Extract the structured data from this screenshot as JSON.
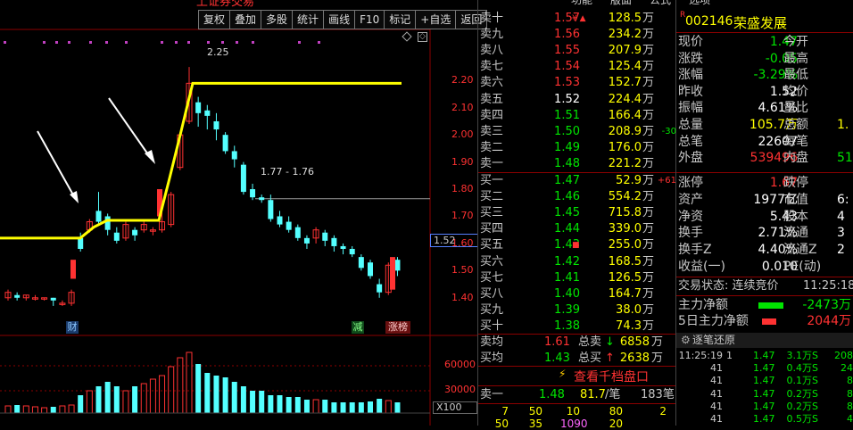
{
  "header": {
    "top_tabs": [
      "功能",
      "版面",
      "公式",
      "选项"
    ],
    "title_fragment": "上证券交易"
  },
  "toolbar": {
    "buttons": [
      "复权",
      "叠加",
      "多股",
      "统计",
      "画线",
      "F10",
      "标记",
      "+自选",
      "返回"
    ]
  },
  "chart": {
    "price_labels": [
      "2.20",
      "2.10",
      "2.00",
      "1.90",
      "1.80",
      "1.70",
      "1.60",
      "1.50",
      "1.40"
    ],
    "volume_labels": [
      "60000",
      "30000"
    ],
    "volume_unit": "X100",
    "current_price_tag": "1.52",
    "high_annotation": "2.25",
    "range_annotation": "1.77 - 1.76",
    "event_tags": [
      "财",
      "减",
      "涨榜"
    ],
    "colors": {
      "up": "#ff3232",
      "down": "#54ffff",
      "ma": "#ffff00",
      "bg": "#000000"
    }
  },
  "chart_data": {
    "type": "candlestick",
    "ylim": [
      1.35,
      2.27
    ],
    "ma_line_label": "",
    "candles": [
      {
        "o": 1.4,
        "c": 1.42,
        "h": 1.43,
        "l": 1.39
      },
      {
        "o": 1.41,
        "c": 1.4,
        "h": 1.42,
        "l": 1.39
      },
      {
        "o": 1.4,
        "c": 1.41,
        "h": 1.41,
        "l": 1.39
      },
      {
        "o": 1.4,
        "c": 1.4,
        "h": 1.41,
        "l": 1.39
      },
      {
        "o": 1.4,
        "c": 1.4,
        "h": 1.4,
        "l": 1.39
      },
      {
        "o": 1.4,
        "c": 1.39,
        "h": 1.4,
        "l": 1.37
      },
      {
        "o": 1.38,
        "c": 1.38,
        "h": 1.39,
        "l": 1.37
      },
      {
        "o": 1.38,
        "c": 1.42,
        "h": 1.43,
        "l": 1.37
      },
      {
        "o": 1.62,
        "c": 1.58,
        "h": 1.64,
        "l": 1.57
      },
      {
        "o": 1.65,
        "c": 1.68,
        "h": 1.69,
        "l": 1.64
      },
      {
        "o": 1.72,
        "c": 1.68,
        "h": 1.79,
        "l": 1.67
      },
      {
        "o": 1.7,
        "c": 1.65,
        "h": 1.71,
        "l": 1.63
      },
      {
        "o": 1.64,
        "c": 1.61,
        "h": 1.66,
        "l": 1.6
      },
      {
        "o": 1.62,
        "c": 1.67,
        "h": 1.68,
        "l": 1.61
      },
      {
        "o": 1.65,
        "c": 1.63,
        "h": 1.66,
        "l": 1.61
      },
      {
        "o": 1.65,
        "c": 1.67,
        "h": 1.68,
        "l": 1.64
      },
      {
        "o": 1.65,
        "c": 1.65,
        "h": 1.66,
        "l": 1.63
      },
      {
        "o": 1.65,
        "c": 1.68,
        "h": 1.7,
        "l": 1.64
      },
      {
        "o": 1.67,
        "c": 1.78,
        "h": 1.79,
        "l": 1.66
      },
      {
        "o": 1.88,
        "c": 2.0,
        "h": 2.01,
        "l": 1.87
      },
      {
        "o": 2.05,
        "c": 2.19,
        "h": 2.25,
        "l": 2.04
      },
      {
        "o": 2.12,
        "c": 2.08,
        "h": 2.14,
        "l": 2.03
      },
      {
        "o": 2.09,
        "c": 2.07,
        "h": 2.11,
        "l": 2.02
      },
      {
        "o": 2.05,
        "c": 2.02,
        "h": 2.08,
        "l": 1.98
      },
      {
        "o": 2.0,
        "c": 1.94,
        "h": 2.01,
        "l": 1.93
      },
      {
        "o": 1.94,
        "c": 1.91,
        "h": 1.96,
        "l": 1.88
      },
      {
        "o": 1.89,
        "c": 1.79,
        "h": 1.9,
        "l": 1.78
      },
      {
        "o": 1.8,
        "c": 1.77,
        "h": 1.82,
        "l": 1.76
      },
      {
        "o": 1.77,
        "c": 1.76,
        "h": 1.78,
        "l": 1.75
      },
      {
        "o": 1.76,
        "c": 1.69,
        "h": 1.78,
        "l": 1.68
      },
      {
        "o": 1.7,
        "c": 1.67,
        "h": 1.72,
        "l": 1.66
      },
      {
        "o": 1.68,
        "c": 1.65,
        "h": 1.7,
        "l": 1.64
      },
      {
        "o": 1.66,
        "c": 1.62,
        "h": 1.67,
        "l": 1.61
      },
      {
        "o": 1.62,
        "c": 1.6,
        "h": 1.63,
        "l": 1.58
      },
      {
        "o": 1.62,
        "c": 1.65,
        "h": 1.66,
        "l": 1.6
      },
      {
        "o": 1.64,
        "c": 1.61,
        "h": 1.65,
        "l": 1.59
      },
      {
        "o": 1.62,
        "c": 1.59,
        "h": 1.63,
        "l": 1.57
      },
      {
        "o": 1.59,
        "c": 1.58,
        "h": 1.6,
        "l": 1.56
      },
      {
        "o": 1.58,
        "c": 1.56,
        "h": 1.59,
        "l": 1.55
      },
      {
        "o": 1.55,
        "c": 1.51,
        "h": 1.56,
        "l": 1.5
      },
      {
        "o": 1.53,
        "c": 1.48,
        "h": 1.54,
        "l": 1.47
      },
      {
        "o": 1.45,
        "c": 1.42,
        "h": 1.47,
        "l": 1.4
      },
      {
        "o": 1.42,
        "c": 1.52,
        "h": 1.53,
        "l": 1.41
      },
      {
        "o": 1.54,
        "c": 1.5,
        "h": 1.55,
        "l": 1.48
      }
    ],
    "ma": [
      1.62,
      1.62,
      1.62,
      1.62,
      1.62,
      1.62,
      1.63,
      1.65,
      1.66,
      1.67,
      1.68,
      1.68,
      1.68,
      1.68,
      1.68,
      1.68,
      1.68,
      1.68,
      1.75,
      1.85,
      2.0,
      2.18,
      2.19,
      2.19,
      2.19,
      2.19,
      2.19,
      2.19,
      2.19,
      2.19,
      2.19,
      2.19,
      2.19,
      2.19
    ],
    "volumes": [
      8000,
      9000,
      8000,
      7000,
      6000,
      7000,
      8000,
      9000,
      20000,
      25000,
      30000,
      35000,
      30000,
      25000,
      30000,
      33000,
      38000,
      42000,
      52000,
      62000,
      68000,
      55000,
      45000,
      42000,
      40000,
      35000,
      30000,
      25000,
      25000,
      20000,
      20000,
      18000,
      18000,
      15000,
      15000,
      15000,
      12000,
      12000,
      12000,
      12000,
      13000,
      16000,
      14000,
      12000
    ]
  },
  "orderbook": {
    "sell": [
      {
        "label": "卖十",
        "price": "1.57",
        "vol": "128.5",
        "unit": "万",
        "mark": "¥ ▲",
        "color": "red"
      },
      {
        "label": "卖九",
        "price": "1.56",
        "vol": "234.2",
        "unit": "万",
        "color": "red"
      },
      {
        "label": "卖八",
        "price": "1.55",
        "vol": "207.9",
        "unit": "万",
        "color": "red"
      },
      {
        "label": "卖七",
        "price": "1.54",
        "vol": "125.4",
        "unit": "万",
        "color": "red"
      },
      {
        "label": "卖六",
        "price": "1.53",
        "vol": "152.7",
        "unit": "万",
        "color": "red"
      },
      {
        "label": "卖五",
        "price": "1.52",
        "vol": "224.4",
        "unit": "万",
        "color": "white"
      },
      {
        "label": "卖四",
        "price": "1.51",
        "vol": "166.4",
        "unit": "万",
        "color": "green"
      },
      {
        "label": "卖三",
        "price": "1.50",
        "vol": "208.9",
        "unit": "万",
        "chg": "-30",
        "color": "green"
      },
      {
        "label": "卖二",
        "price": "1.49",
        "vol": "176.0",
        "unit": "万",
        "color": "green"
      },
      {
        "label": "卖一",
        "price": "1.48",
        "vol": "221.2",
        "unit": "万",
        "color": "green"
      }
    ],
    "buy": [
      {
        "label": "买一",
        "price": "1.47",
        "vol": "52.9",
        "unit": "万",
        "chg": "+61",
        "color": "green"
      },
      {
        "label": "买二",
        "price": "1.46",
        "vol": "554.2",
        "unit": "万",
        "color": "green"
      },
      {
        "label": "买三",
        "price": "1.45",
        "vol": "715.8",
        "unit": "万",
        "color": "green"
      },
      {
        "label": "买四",
        "price": "1.44",
        "vol": "339.0",
        "unit": "万",
        "color": "green"
      },
      {
        "label": "买五",
        "price": "1.43",
        "vol": "255.0",
        "unit": "万",
        "mark": "■",
        "color": "green"
      },
      {
        "label": "买六",
        "price": "1.42",
        "vol": "168.5",
        "unit": "万",
        "color": "green"
      },
      {
        "label": "买七",
        "price": "1.41",
        "vol": "126.5",
        "unit": "万",
        "color": "green"
      },
      {
        "label": "买八",
        "price": "1.40",
        "vol": "164.7",
        "unit": "万",
        "color": "green"
      },
      {
        "label": "买九",
        "price": "1.39",
        "vol": "38.0",
        "unit": "万",
        "color": "green"
      },
      {
        "label": "买十",
        "price": "1.38",
        "vol": "74.3",
        "unit": "万",
        "color": "green"
      }
    ],
    "avg": [
      {
        "label": "卖均",
        "price": "1.61",
        "tlabel": "总卖",
        "arrow": "↓",
        "total": "6858",
        "unit": "万"
      },
      {
        "label": "买均",
        "price": "1.43",
        "tlabel": "总买",
        "arrow": "↑",
        "total": "2638",
        "unit": "万"
      }
    ],
    "depth_link": "查看千档盘口",
    "queue": {
      "label": "卖一",
      "price": "1.48",
      "vol": "81.7",
      "unit": "/笔",
      "count": "183笔"
    },
    "queue_rows": [
      [
        "7",
        "50",
        "10",
        "80",
        "2"
      ],
      [
        "50",
        "35",
        "1090",
        "20",
        ""
      ]
    ]
  },
  "quote": {
    "badge": "R",
    "code": "002146",
    "name": "荣盛发展",
    "rows": [
      {
        "l1": "现价",
        "v1": "1.47",
        "c1": "green",
        "l2": "今开",
        "v2": "",
        "c2": ""
      },
      {
        "l1": "涨跌",
        "v1": "-0.05",
        "c1": "green",
        "l2": "最高",
        "v2": "",
        "c2": ""
      },
      {
        "l1": "涨幅",
        "v1": "-3.29%",
        "c1": "green",
        "l2": "最低",
        "v2": "",
        "c2": ""
      },
      {
        "l1": "昨收",
        "v1": "1.52",
        "c1": "white",
        "l2": "均价",
        "v2": "",
        "c2": ""
      },
      {
        "l1": "振幅",
        "v1": "4.61%",
        "c1": "white",
        "l2": "量比",
        "v2": "",
        "c2": ""
      },
      {
        "l1": "总量",
        "v1": "105.7万",
        "c1": "yellow",
        "l2": "总额",
        "v2": "1.",
        "c2": "yellow"
      },
      {
        "l1": "总笔",
        "v1": "22607",
        "c1": "white",
        "l2": "每笔",
        "v2": "",
        "c2": ""
      },
      {
        "l1": "外盘",
        "v1": "539496",
        "c1": "red",
        "l2": "内盘",
        "v2": "51",
        "c2": "green"
      },
      {
        "l1": "涨停",
        "v1": "1.67",
        "c1": "red",
        "l2": "跌停",
        "v2": "",
        "c2": ""
      },
      {
        "l1": "资产",
        "v1": "1977亿",
        "c1": "white",
        "l2": "市值",
        "v2": "6:",
        "c2": "white"
      },
      {
        "l1": "净资",
        "v1": "5.43",
        "c1": "white",
        "l2": "股本",
        "v2": "4",
        "c2": "white"
      },
      {
        "l1": "换手",
        "v1": "2.71%",
        "c1": "white",
        "l2": "流通",
        "v2": "3",
        "c2": "white"
      },
      {
        "l1": "换手Z",
        "v1": "4.40%",
        "c1": "white",
        "l2": "流通Z",
        "v2": "2",
        "c2": "white"
      },
      {
        "l1": "收益(一)",
        "v1": "0.010",
        "c1": "white",
        "l2": "PE(动)",
        "v2": "",
        "c2": ""
      }
    ],
    "trade_status_label": "交易状态: 连续竞价",
    "trade_time": "11:25:18",
    "main_flow_label": "主力净额",
    "main_flow_value": "-2473万",
    "flow5_label": "5日主力净额",
    "flow5_value": "2044万",
    "ticks_title": "逐笔还原",
    "ticks": [
      [
        "11:25:19",
        "1",
        "1.47",
        "3.1万",
        "S",
        "208"
      ],
      [
        "41",
        "",
        "1.47",
        "0.4万",
        "S",
        "24"
      ],
      [
        "41",
        "",
        "1.47",
        "0.1万",
        "S",
        "8"
      ],
      [
        "41",
        "",
        "1.47",
        "0.2万",
        "S",
        "8"
      ],
      [
        "41",
        "",
        "1.47",
        "0.2万",
        "S",
        "8"
      ],
      [
        "41",
        "",
        "1.47",
        "0.5万",
        "S",
        "4"
      ]
    ]
  }
}
